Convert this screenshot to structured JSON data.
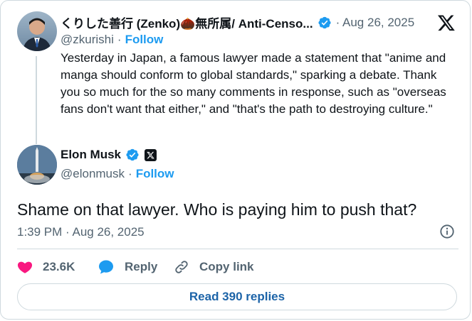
{
  "quoted_tweet": {
    "name": "くりした善行 (Zenko)🌰無所属/ Anti-Censo...",
    "handle": "@zkurishi",
    "follow_label": "Follow",
    "date": "Aug 26, 2025",
    "text": "Yesterday in Japan, a famous lawyer made a statement that \"anime and manga should conform to global standards,\" sparking a debate. Thank you so much for the so many comments in response, such as \"overseas fans don't want that either,\" and \"that's the path to destroying culture.\""
  },
  "main_tweet": {
    "name": "Elon Musk",
    "handle": "@elonmusk",
    "follow_label": "Follow",
    "text": "Shame on that lawyer. Who is paying him to push that?",
    "timestamp": "1:39 PM · Aug 26, 2025"
  },
  "actions": {
    "like_count": "23.6K",
    "reply_label": "Reply",
    "copy_label": "Copy link"
  },
  "read_replies_label": "Read 390 replies",
  "colors": {
    "accent": "#1d9bf0",
    "like": "#f91880",
    "text": "#0f1419",
    "muted": "#536471",
    "border": "#cfd9de"
  },
  "icons": [
    "x-logo-icon",
    "verified-badge-icon",
    "heart-icon",
    "reply-bubble-icon",
    "link-icon",
    "info-icon"
  ]
}
